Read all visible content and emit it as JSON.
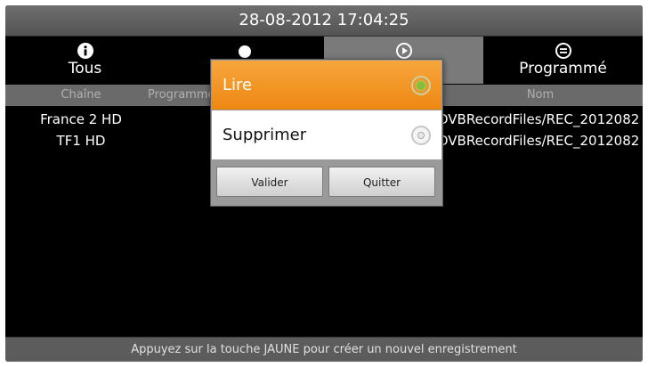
{
  "header": {
    "datetime": "28-08-2012 17:04:25"
  },
  "tabs": [
    {
      "label": "Tous",
      "icon": "info-icon",
      "active": false
    },
    {
      "label": "",
      "icon": "record-dot-icon",
      "active": false
    },
    {
      "label": "",
      "icon": "play-icon",
      "active": true
    },
    {
      "label": "Programmé",
      "icon": "scheduled-icon",
      "active": false
    }
  ],
  "table": {
    "columns": [
      "Chaîne",
      "Programme",
      "Nom"
    ],
    "rows": [
      {
        "channel": "France 2 HD",
        "name": "DVBRecordFiles/REC_2012082"
      },
      {
        "channel": "TF1 HD",
        "name": "DVBRecordFiles/REC_2012082"
      }
    ]
  },
  "dialog": {
    "options": [
      {
        "label": "Lire",
        "selected": true
      },
      {
        "label": "Supprimer",
        "selected": false
      }
    ],
    "confirm_label": "Valider",
    "quit_label": "Quitter"
  },
  "footer": {
    "hint": "Appuyez sur la touche JAUNE pour créer un nouvel enregistrement"
  },
  "colors": {
    "accent": "#ee8712",
    "active_tab": "#7a7a7a",
    "background": "#000000"
  }
}
